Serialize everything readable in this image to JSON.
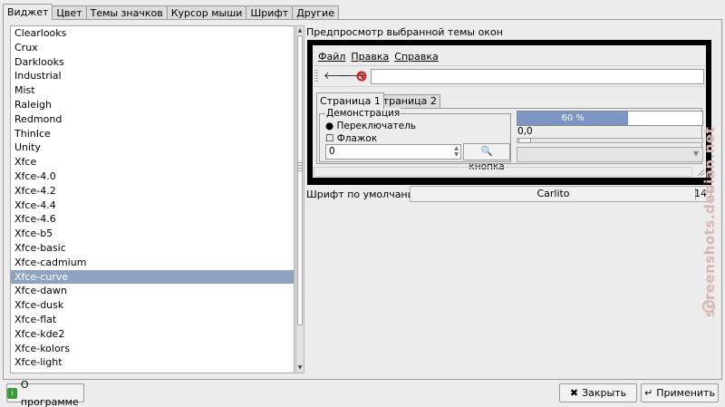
{
  "tabs": [
    "Виджет",
    "Цвет",
    "Темы значков",
    "Курсор мыши",
    "Шрифт",
    "Другие"
  ],
  "themes": {
    "items": [
      "Clearlooks",
      "Crux",
      "Darklooks",
      "Industrial",
      "Mist",
      "Raleigh",
      "Redmond",
      "ThinIce",
      "Unity",
      "Xfce",
      "Xfce-4.0",
      "Xfce-4.2",
      "Xfce-4.4",
      "Xfce-4.6",
      "Xfce-b5",
      "Xfce-basic",
      "Xfce-cadmium",
      "Xfce-curve",
      "Xfce-dawn",
      "Xfce-dusk",
      "Xfce-flat",
      "Xfce-kde2",
      "Xfce-kolors",
      "Xfce-light"
    ],
    "selected": "Xfce-curve"
  },
  "preview": {
    "label": "Предпросмотр выбранной темы окон",
    "menu": [
      "Файл",
      "Правка",
      "Справка"
    ],
    "tabs": [
      "Страница 1",
      "Страница 2"
    ],
    "demo_legend": "Демонстрация",
    "radio_label": "Переключатель",
    "check_label": "Флажок",
    "spin_value": "0",
    "button_label": "кнопка",
    "progress_text": "60 %",
    "progress_fraction": 0.6,
    "scale_value": "0,0"
  },
  "font": {
    "label": "Шрифт по умолчанию:",
    "name": "Carlito",
    "size": "14"
  },
  "buttons": {
    "about": "О программе",
    "close": "Закрыть",
    "apply": "Применить"
  },
  "watermark": "screenshots.debian.net",
  "colors": {
    "selection": "#8ea2c2",
    "progress": "#7d95c4",
    "stop_icon": "#d02020"
  }
}
